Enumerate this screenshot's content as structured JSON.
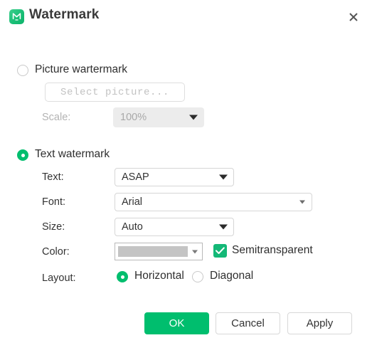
{
  "window": {
    "title": "Watermark",
    "app_icon": "watermark-app-icon",
    "close_icon": "close-icon"
  },
  "picture_section": {
    "radio_label": "Picture wartermark",
    "radio_selected": false,
    "select_picture_button": "Select picture...",
    "scale_label": "Scale:",
    "scale_value": "100%",
    "scale_disabled": true
  },
  "text_section": {
    "radio_label": "Text watermark",
    "radio_selected": true,
    "fields": {
      "text_label": "Text:",
      "text_value": "ASAP",
      "font_label": "Font:",
      "font_value": "Arial",
      "size_label": "Size:",
      "size_value": "Auto",
      "color_label": "Color:",
      "color_value": "#c4c4c4",
      "semitransparent_label": "Semitransparent",
      "semitransparent_checked": true,
      "layout_label": "Layout:",
      "layout_horizontal": "Horizontal",
      "layout_diagonal": "Diagonal",
      "layout_selected": "Horizontal"
    }
  },
  "footer": {
    "ok_label": "OK",
    "cancel_label": "Cancel",
    "apply_label": "Apply"
  },
  "colors": {
    "accent_green": "#00be6e",
    "checkbox_green": "#14b877",
    "disabled_gray": "#ececec",
    "text_dark": "#333333"
  }
}
